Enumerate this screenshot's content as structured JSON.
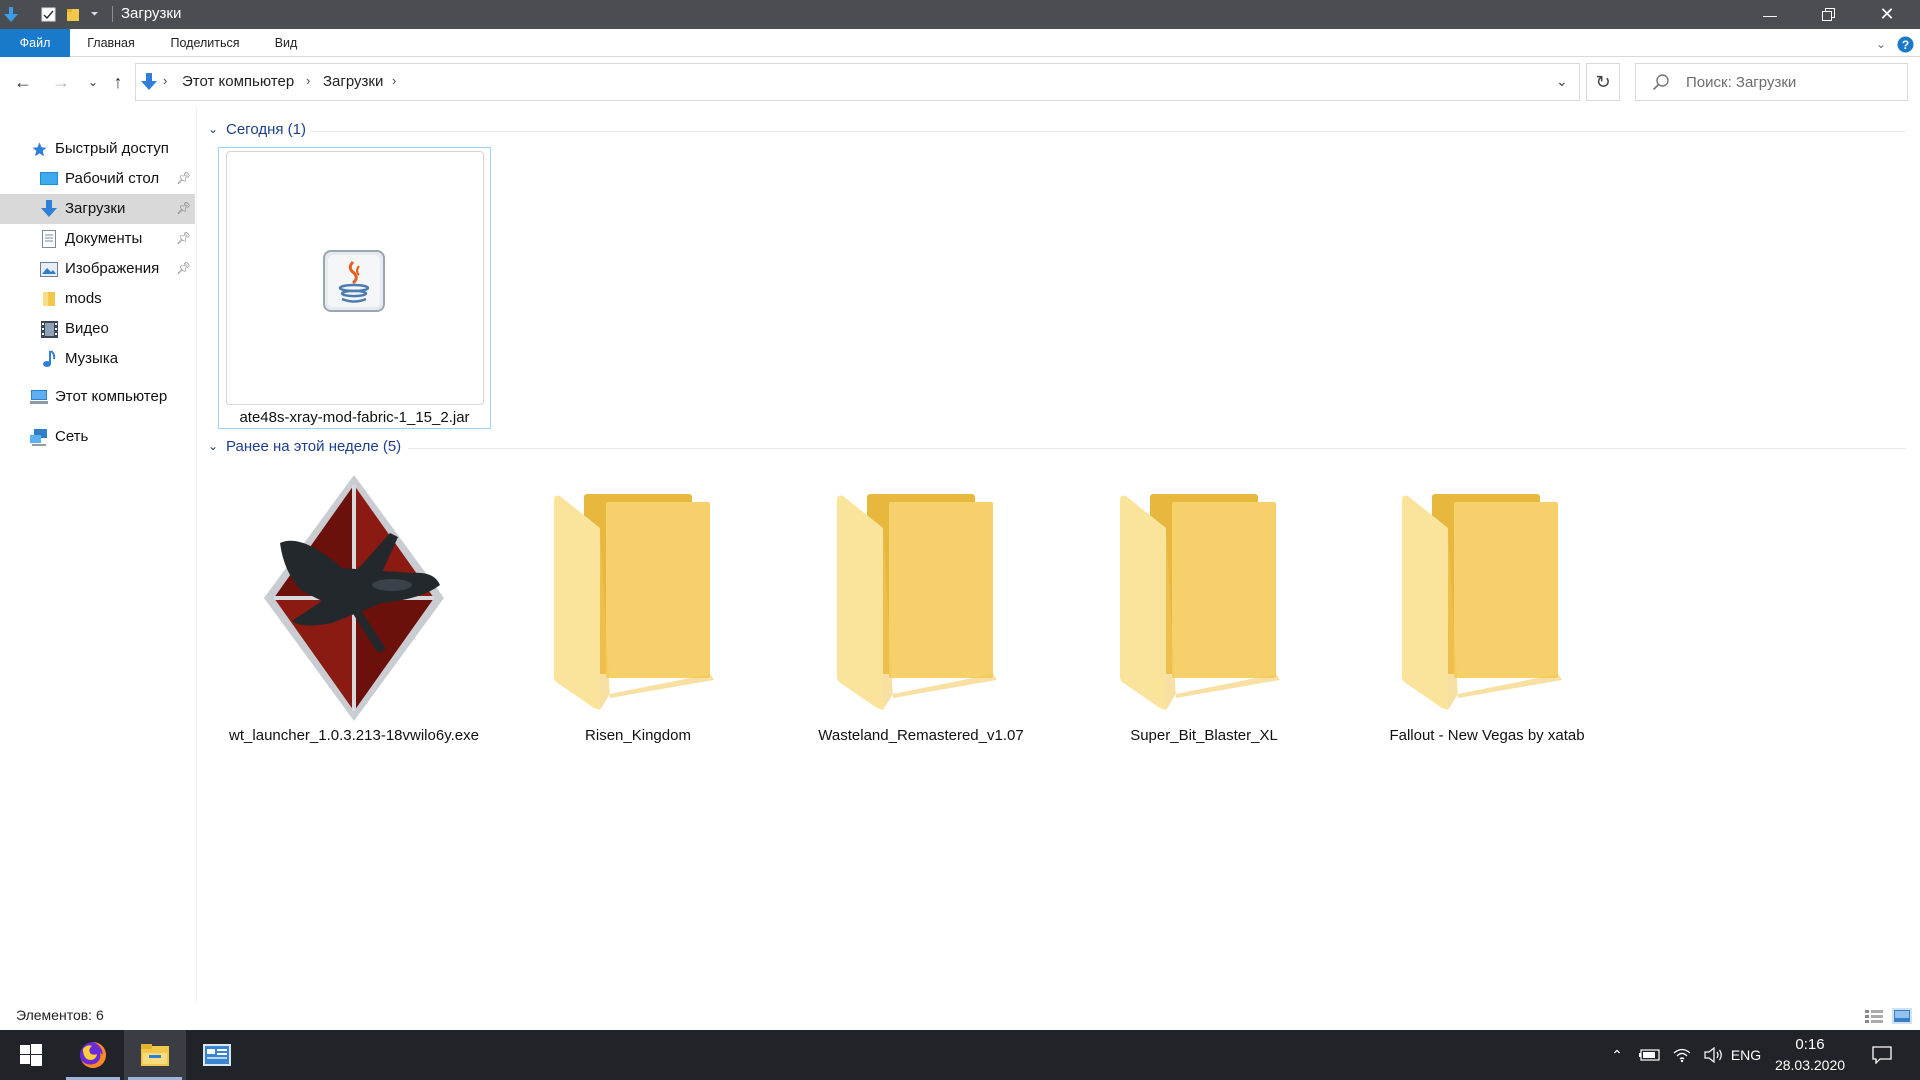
{
  "window": {
    "title": "Загрузки"
  },
  "ribbon": {
    "tabs": [
      "Файл",
      "Главная",
      "Поделиться",
      "Вид"
    ]
  },
  "address": {
    "segments": [
      "Этот компьютер",
      "Загрузки"
    ],
    "search_placeholder": "Поиск: Загрузки"
  },
  "sidebar": {
    "quick_access": "Быстрый доступ",
    "items": [
      {
        "label": "Рабочий стол",
        "icon": "desktop-icon",
        "pinned": true
      },
      {
        "label": "Загрузки",
        "icon": "downloads-icon",
        "pinned": true,
        "selected": true
      },
      {
        "label": "Документы",
        "icon": "documents-icon",
        "pinned": true
      },
      {
        "label": "Изображения",
        "icon": "pictures-icon",
        "pinned": true
      },
      {
        "label": "mods",
        "icon": "folder-icon",
        "pinned": false
      },
      {
        "label": "Видео",
        "icon": "video-icon",
        "pinned": false
      },
      {
        "label": "Музыка",
        "icon": "music-icon",
        "pinned": false
      }
    ],
    "this_pc": "Этот компьютер",
    "network": "Сеть"
  },
  "groups": {
    "today": {
      "title": "Сегодня (1)",
      "files": [
        {
          "name": "ate48s-xray-mod-fabric-1_15_2.jar",
          "icon": "java-jar-icon",
          "selected": true
        }
      ]
    },
    "earlier": {
      "title": "Ранее на этой неделе (5)",
      "files": [
        {
          "name": "wt_launcher_1.0.3.213-18vwilo6y.exe",
          "icon": "war-thunder-launcher-icon"
        },
        {
          "name": "Risen_Kingdom",
          "icon": "folder-icon"
        },
        {
          "name": "Wasteland_Remastered_v1.07",
          "icon": "folder-icon"
        },
        {
          "name": "Super_Bit_Blaster_XL",
          "icon": "folder-icon"
        },
        {
          "name": "Fallout - New Vegas by xatab",
          "icon": "folder-icon"
        }
      ]
    }
  },
  "status": {
    "items_count": "Элементов: 6"
  },
  "taskbar": {
    "apps": [
      "start-icon",
      "firefox-icon",
      "file-explorer-icon",
      "control-panel-icon"
    ],
    "language": "ENG",
    "time": "0:16",
    "date": "28.03.2020"
  },
  "colors": {
    "accent": "#1979ca",
    "titlebar": "#4a4d51",
    "taskbar": "#202327",
    "folder": "#f8d675",
    "group_title": "#1e3f8c"
  }
}
